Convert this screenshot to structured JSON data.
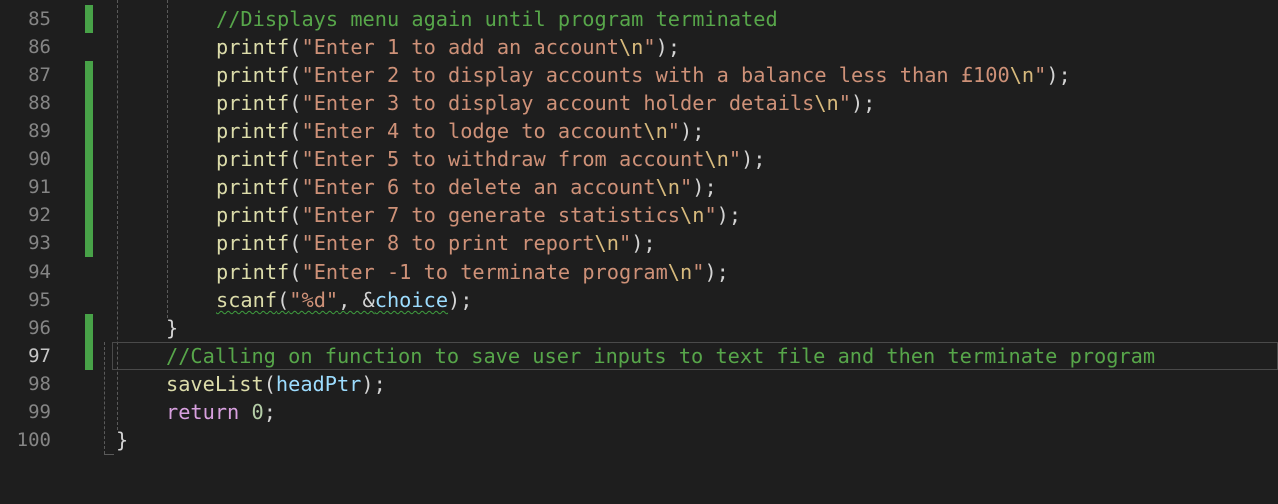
{
  "editor": {
    "active_line": "97",
    "lines": [
      {
        "num": "85",
        "comment": "//Displays menu again until program terminated"
      },
      {
        "num": "86",
        "fn": "printf",
        "open": "(",
        "str": "\"Enter 1 to add an account",
        "esc": "\\n",
        "strEnd": "\"",
        "close": ");"
      },
      {
        "num": "87",
        "fn": "printf",
        "open": "(",
        "str": "\"Enter 2 to display accounts with a balance less than £100",
        "esc": "\\n",
        "strEnd": "\"",
        "close": ");"
      },
      {
        "num": "88",
        "fn": "printf",
        "open": "(",
        "str": "\"Enter 3 to display account holder details",
        "esc": "\\n",
        "strEnd": "\"",
        "close": ");"
      },
      {
        "num": "89",
        "fn": "printf",
        "open": "(",
        "str": "\"Enter 4 to lodge to account",
        "esc": "\\n",
        "strEnd": "\"",
        "close": ");"
      },
      {
        "num": "90",
        "fn": "printf",
        "open": "(",
        "str": "\"Enter 5 to withdraw from account",
        "esc": "\\n",
        "strEnd": "\"",
        "close": ");"
      },
      {
        "num": "91",
        "fn": "printf",
        "open": "(",
        "str": "\"Enter 6 to delete an account",
        "esc": "\\n",
        "strEnd": "\"",
        "close": ");"
      },
      {
        "num": "92",
        "fn": "printf",
        "open": "(",
        "str": "\"Enter 7 to generate statistics",
        "esc": "\\n",
        "strEnd": "\"",
        "close": ");"
      },
      {
        "num": "93",
        "fn": "printf",
        "open": "(",
        "str": "\"Enter 8 to print report",
        "esc": "\\n",
        "strEnd": "\"",
        "close": ");"
      },
      {
        "num": "94",
        "fn": "printf",
        "open": "(",
        "str": "\"Enter -1 to terminate program",
        "esc": "\\n",
        "strEnd": "\"",
        "close": ");"
      },
      {
        "num": "95",
        "fn": "scanf",
        "open": "(",
        "str": "\"%d\"",
        "sep": ", &",
        "var": "choice",
        "close": ");"
      },
      {
        "num": "96",
        "brace": "}"
      },
      {
        "num": "97",
        "comment": "//Calling on function to save user inputs to text file and then terminate program"
      },
      {
        "num": "98",
        "fn": "saveList",
        "open": "(",
        "var": "headPtr",
        "close": ");"
      },
      {
        "num": "99",
        "kw": "return",
        "num_literal": "0",
        "close": ";"
      },
      {
        "num": "100",
        "brace": "}"
      }
    ]
  },
  "colors": {
    "background": "#1e1e1e",
    "function": "#dcdcaa",
    "string": "#ce9178",
    "escape": "#d7ba7d",
    "comment": "#57a64a",
    "keyword": "#d8a0df",
    "variable": "#9cdcfe",
    "number": "#b5cea8",
    "change_bar": "#48a248"
  }
}
